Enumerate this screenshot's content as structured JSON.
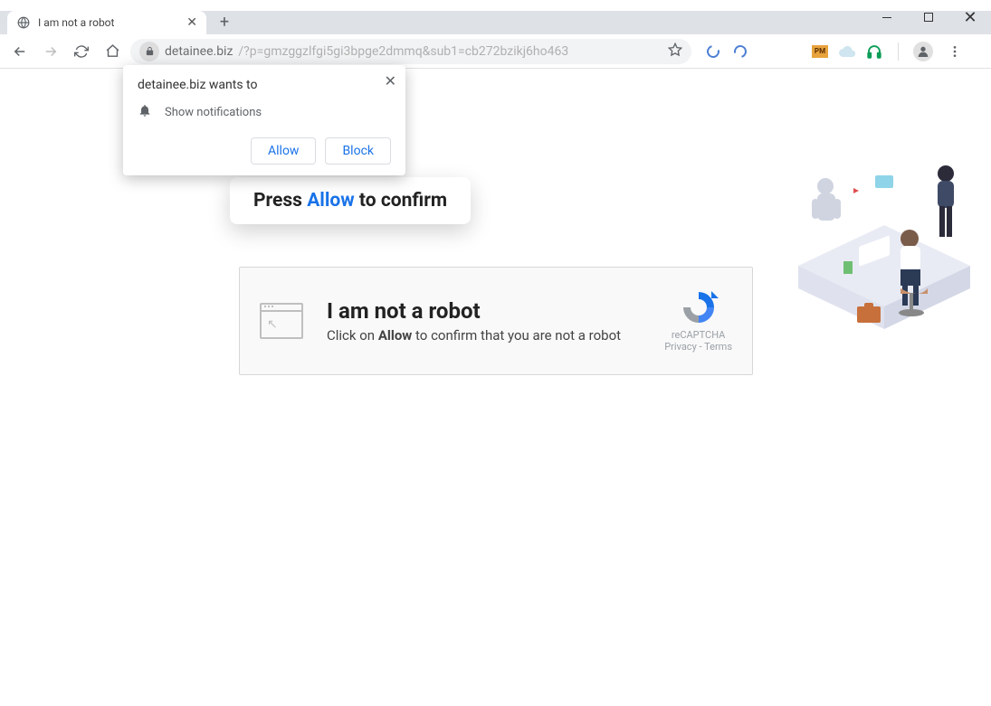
{
  "window": {
    "minimize_tooltip": "Minimize",
    "maximize_tooltip": "Maximize",
    "close_tooltip": "Close"
  },
  "tab": {
    "title": "I am not a robot",
    "close_tooltip": "Close tab",
    "newtab_tooltip": "New tab"
  },
  "toolbar": {
    "back_tooltip": "Back",
    "forward_tooltip": "Forward",
    "reload_tooltip": "Reload",
    "home_tooltip": "Home",
    "url_host": "detainee.biz",
    "url_path": "/?p=gmzggzlfgi5gi3bpge2dmmq&sub1=cb272bzikj6ho463",
    "bookmark_tooltip": "Bookmark this page",
    "menu_tooltip": "Customize and control"
  },
  "permission": {
    "title": "detainee.biz wants to",
    "item": "Show notifications",
    "allow_label": "Allow",
    "block_label": "Block"
  },
  "hint": {
    "prefix": "Press",
    "keyword": "Allow",
    "suffix": "to confirm"
  },
  "captcha": {
    "heading": "I am not a robot",
    "line_prefix": "Click on",
    "line_keyword": "Allow",
    "line_suffix": "to confirm that you are not a robot",
    "badge": "reCAPTCHA",
    "privacy": "Privacy",
    "terms": "Terms",
    "sep": " - "
  }
}
